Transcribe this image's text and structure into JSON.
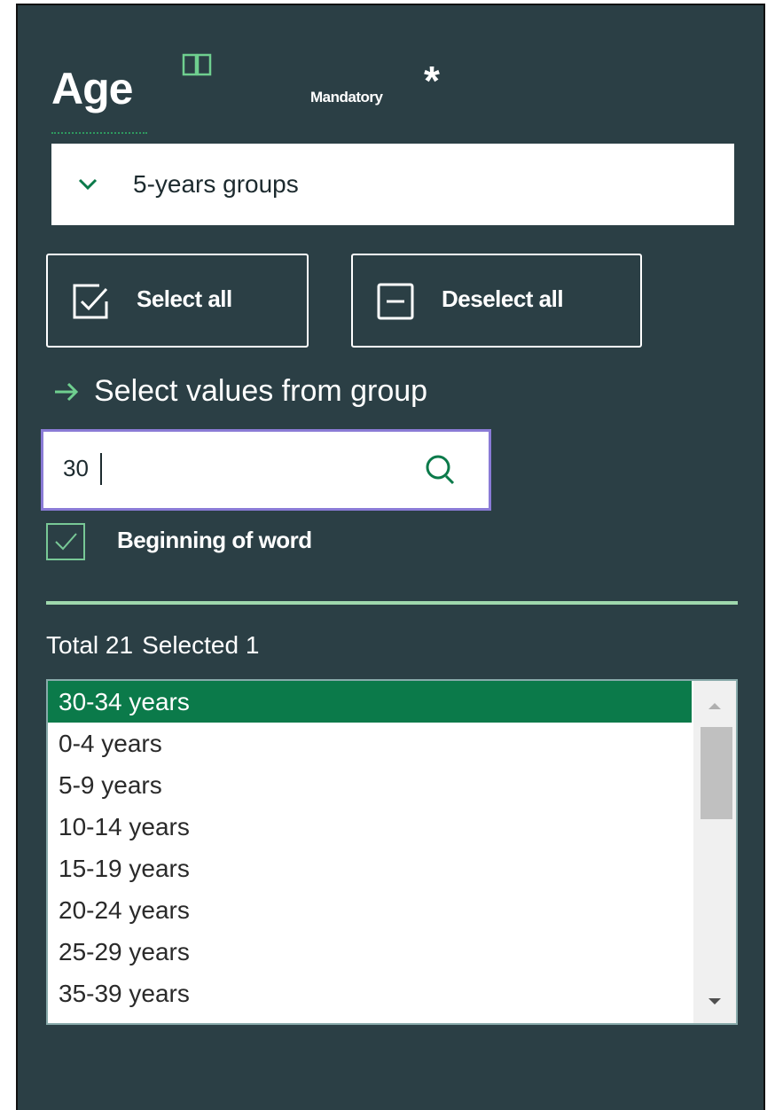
{
  "field": {
    "title": "Age",
    "mandatory_label": "Mandatory",
    "asterisk": "*"
  },
  "grouping": {
    "selected": "5-years groups"
  },
  "buttons": {
    "select_all": "Select all",
    "deselect_all": "Deselect all"
  },
  "group_link": "Select values from group",
  "search": {
    "value": "30"
  },
  "options": {
    "beginning_of_word": "Beginning of word",
    "beginning_of_word_checked": true
  },
  "totals": {
    "total_label": "Total 21",
    "selected_label": "Selected 1"
  },
  "list": {
    "items": [
      {
        "label": "30-34 years",
        "selected": true
      },
      {
        "label": "0-4 years",
        "selected": false
      },
      {
        "label": "5-9 years",
        "selected": false
      },
      {
        "label": "10-14 years",
        "selected": false
      },
      {
        "label": "15-19 years",
        "selected": false
      },
      {
        "label": "20-24 years",
        "selected": false
      },
      {
        "label": "25-29 years",
        "selected": false
      },
      {
        "label": "35-39 years",
        "selected": false
      }
    ]
  },
  "colors": {
    "panel_bg": "#2b3f45",
    "accent_green": "#0b7a4a",
    "search_focus": "#8a7bd6"
  }
}
